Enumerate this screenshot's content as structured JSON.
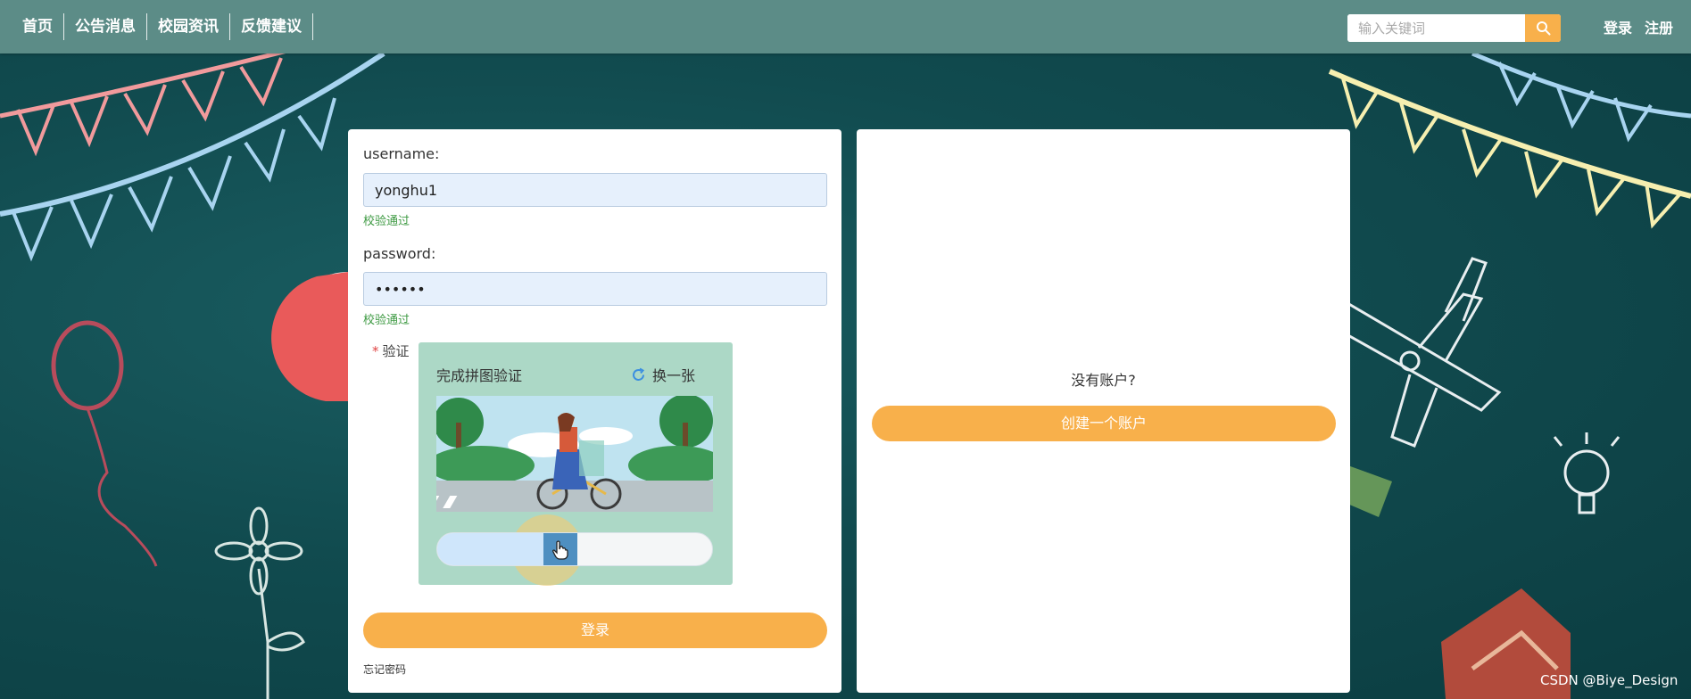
{
  "nav": {
    "items": [
      {
        "label": "首页"
      },
      {
        "label": "公告消息"
      },
      {
        "label": "校园资讯"
      },
      {
        "label": "反馈建议"
      }
    ],
    "search_placeholder": "输入关键词",
    "search_value": "",
    "login_label": "登录",
    "register_label": "注册"
  },
  "login_form": {
    "username_label": "username:",
    "username_value": "yonghu1",
    "username_status": "校验通过",
    "password_label": "password:",
    "password_value": "••••••",
    "password_status": "校验通过",
    "captcha_required_mark": "*",
    "captcha_label": "验证",
    "captcha_title": "完成拼图验证",
    "captcha_refresh_label": "换一张",
    "slider_progress": 0.4,
    "submit_label": "登录",
    "forgot_label": "忘记密码"
  },
  "register_panel": {
    "prompt": "没有账户?",
    "create_label": "创建一个账户"
  },
  "watermark": "CSDN @Biye_Design",
  "colors": {
    "topbar": "#5c8c87",
    "accent": "#f8b04b",
    "success": "#3e9a43",
    "captcha_bg": "#acd8c6",
    "board": "#114b4f"
  },
  "icons": {
    "search": "search-icon",
    "refresh": "refresh-icon",
    "slider_handle": "hand-pointer-icon"
  }
}
